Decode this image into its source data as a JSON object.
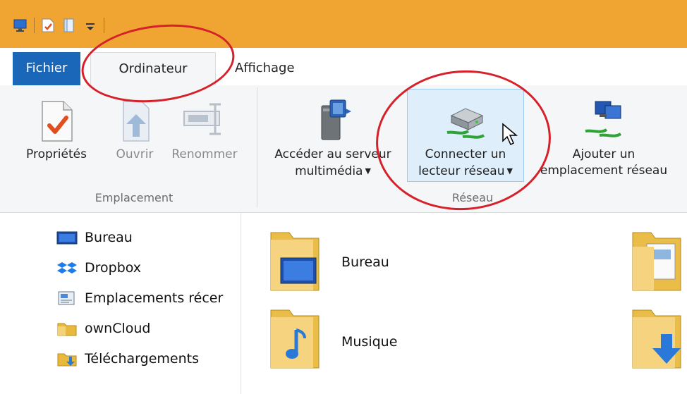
{
  "tabs": {
    "fichier": "Fichier",
    "ordinateur": "Ordinateur",
    "affichage": "Affichage"
  },
  "ribbon": {
    "emplacement": {
      "group_label": "Emplacement",
      "buttons": [
        {
          "label": "Propriétés",
          "state": "enabled"
        },
        {
          "label": "Ouvrir",
          "state": "disabled"
        },
        {
          "label": "Renommer",
          "state": "disabled"
        }
      ]
    },
    "reseau": {
      "group_label": "Réseau",
      "buttons": [
        {
          "line1": "Accéder au serveur",
          "line2": "multimédia"
        },
        {
          "line1": "Connecter un",
          "line2": "lecteur réseau"
        },
        {
          "line1": "Ajouter un",
          "line2": "emplacement réseau"
        }
      ]
    }
  },
  "navigation": {
    "items": [
      {
        "label": "Bureau",
        "icon": "desktop-icon"
      },
      {
        "label": "Dropbox",
        "icon": "dropbox-icon"
      },
      {
        "label": "Emplacements récer",
        "icon": "recent-places-icon"
      },
      {
        "label": "ownCloud",
        "icon": "folder-icon"
      },
      {
        "label": "Téléchargements",
        "icon": "downloads-icon"
      }
    ]
  },
  "folders": [
    {
      "label": "Bureau"
    },
    {
      "label": "Musique"
    }
  ],
  "colors": {
    "titlebar": "#f0a533",
    "file_tab": "#1a66b8",
    "highlight_circle": "#d6202a"
  }
}
